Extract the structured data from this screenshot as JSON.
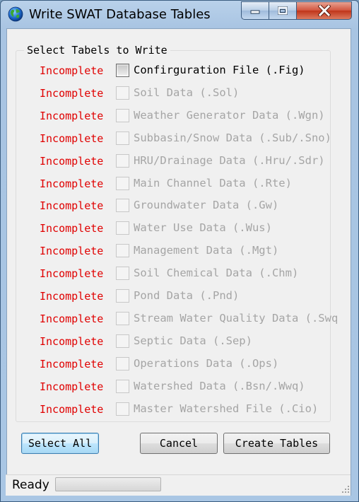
{
  "window": {
    "title": "Write SWAT Database Tables"
  },
  "group": {
    "title": "Select Tabels to Write"
  },
  "tables": [
    {
      "status": "Incomplete",
      "label": "Confirguration File (.Fig)",
      "enabled": true
    },
    {
      "status": "Incomplete",
      "label": "Soil Data (.Sol)",
      "enabled": false
    },
    {
      "status": "Incomplete",
      "label": "Weather Generator Data (.Wgn)",
      "enabled": false
    },
    {
      "status": "Incomplete",
      "label": "Subbasin/Snow Data (.Sub/.Sno)",
      "enabled": false
    },
    {
      "status": "Incomplete",
      "label": "HRU/Drainage Data (.Hru/.Sdr)",
      "enabled": false
    },
    {
      "status": "Incomplete",
      "label": "Main Channel Data (.Rte)",
      "enabled": false
    },
    {
      "status": "Incomplete",
      "label": "Groundwater Data (.Gw)",
      "enabled": false
    },
    {
      "status": "Incomplete",
      "label": "Water Use Data (.Wus)",
      "enabled": false
    },
    {
      "status": "Incomplete",
      "label": "Management Data (.Mgt)",
      "enabled": false
    },
    {
      "status": "Incomplete",
      "label": "Soil Chemical Data (.Chm)",
      "enabled": false
    },
    {
      "status": "Incomplete",
      "label": "Pond Data (.Pnd)",
      "enabled": false
    },
    {
      "status": "Incomplete",
      "label": "Stream Water Quality Data (.Swq",
      "enabled": false
    },
    {
      "status": "Incomplete",
      "label": "Septic Data (.Sep)",
      "enabled": false
    },
    {
      "status": "Incomplete",
      "label": "Operations Data (.Ops)",
      "enabled": false
    },
    {
      "status": "Incomplete",
      "label": "Watershed Data (.Bsn/.Wwq)",
      "enabled": false
    },
    {
      "status": "Incomplete",
      "label": "Master Watershed File (.Cio)",
      "enabled": false
    }
  ],
  "buttons": {
    "select_all": "Select All",
    "cancel": "Cancel",
    "create_tables": "Create Tables"
  },
  "statusbar": {
    "text": "Ready",
    "progress": 0
  },
  "colors": {
    "incomplete": "#e00000",
    "disabled_text": "#a5a5a5",
    "titlebar": "#a9c6e4",
    "close_button": "#c7432a"
  },
  "icons": {
    "app": "globe-icon",
    "minimize": "minimize-icon",
    "maximize": "maximize-icon",
    "close": "close-icon",
    "grip": "resize-grip-icon"
  }
}
